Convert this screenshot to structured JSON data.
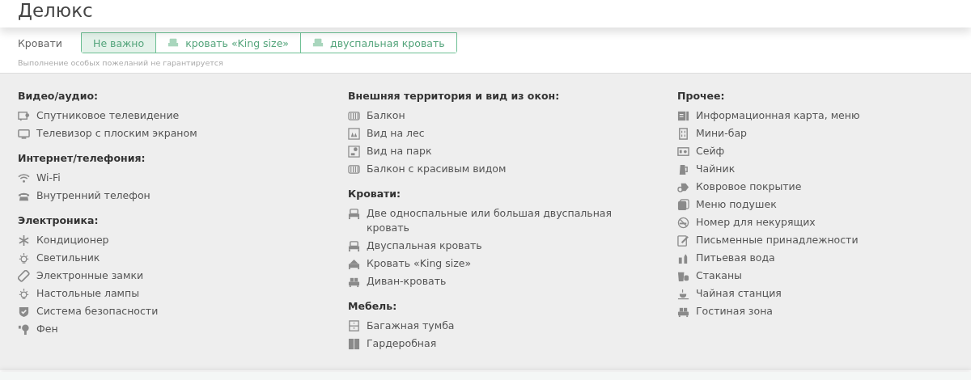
{
  "header": {
    "title": "Делюкс"
  },
  "beds": {
    "label": "Кровати",
    "options": [
      {
        "label": "Не важно",
        "selected": true,
        "kind": "plain"
      },
      {
        "label": "кровать «King size»",
        "selected": false,
        "kind": "bed"
      },
      {
        "label": "двуспальная кровать",
        "selected": false,
        "kind": "bed"
      }
    ],
    "note": "Выполнение особых пожеланий не гарантируется"
  },
  "columns": [
    {
      "groups": [
        {
          "title": "Видео/аудио:",
          "items": [
            "Спутниковое телевидение",
            "Телевизор с плоским экраном"
          ]
        },
        {
          "title": "Интернет/телефония:",
          "items": [
            "Wi-Fi",
            "Внутренний телефон"
          ]
        },
        {
          "title": "Электроника:",
          "items": [
            "Кондиционер",
            "Светильник",
            "Электронные замки",
            "Настольные лампы",
            "Система безопасности",
            "Фен"
          ]
        }
      ]
    },
    {
      "groups": [
        {
          "title": "Внешняя территория и вид из окон:",
          "items": [
            "Балкон",
            "Вид на лес",
            "Вид на парк",
            "Балкон с красивым видом"
          ]
        },
        {
          "title": "Кровати:",
          "items": [
            "Две односпальные или большая двуспальная кровать",
            "Двуспальная кровать",
            "Кровать «King size»",
            "Диван-кровать"
          ]
        },
        {
          "title": "Мебель:",
          "items": [
            "Багажная тумба",
            "Гардеробная"
          ]
        }
      ]
    },
    {
      "groups": [
        {
          "title": "Прочее:",
          "items": [
            "Информационная карта, меню",
            "Мини-бар",
            "Сейф",
            "Чайник",
            "Ковровое покрытие",
            "Меню подушек",
            "Номер для некурящих",
            "Письменные принадлежности",
            "Питьевая вода",
            "Стаканы",
            "Чайная станция",
            "Гостиная зона"
          ]
        }
      ]
    }
  ]
}
